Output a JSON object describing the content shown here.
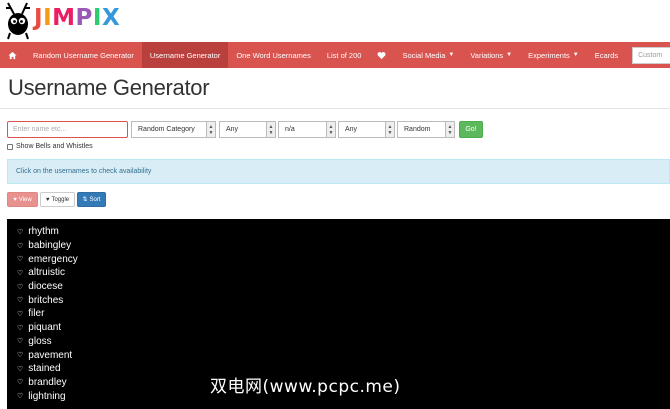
{
  "brand": {
    "letters": [
      {
        "ch": "J",
        "color": "#e94b3c"
      },
      {
        "ch": "I",
        "color": "#f39c12"
      },
      {
        "ch": "M",
        "color": "#e91e63"
      },
      {
        "ch": "P",
        "color": "#9b59b6"
      },
      {
        "ch": "I",
        "color": "#2ecc71"
      },
      {
        "ch": "X",
        "color": "#3498db"
      }
    ]
  },
  "colors": {
    "nav": "#d9534f",
    "nav_active": "#b9403c",
    "go": "#5cb85c",
    "sort": "#337ab7",
    "info_bg": "#d9edf7"
  },
  "nav": {
    "home_icon": "home-icon",
    "items": [
      {
        "label": "Random Username Generator",
        "active": false,
        "caret": false
      },
      {
        "label": "Username Generator",
        "active": true,
        "caret": false
      },
      {
        "label": "One Word Usernames",
        "active": false,
        "caret": false
      },
      {
        "label": "List of 200",
        "active": false,
        "caret": false
      }
    ],
    "heart_icon": "heart-icon",
    "items2": [
      {
        "label": "Social Media",
        "caret": true
      },
      {
        "label": "Variations",
        "caret": true
      },
      {
        "label": "Experiments",
        "caret": true
      },
      {
        "label": "Ecards",
        "caret": false
      }
    ],
    "search_placeholder": "Custom"
  },
  "page": {
    "title": "Username Generator"
  },
  "form": {
    "name_placeholder": "Enter name etc...",
    "selects": [
      {
        "value": "Random Category"
      },
      {
        "value": "Any"
      },
      {
        "value": "n/a"
      },
      {
        "value": "Any"
      },
      {
        "value": "Random"
      }
    ],
    "go_label": "Go!",
    "bells_label": "Show Bells and Whistles"
  },
  "info": {
    "text": "Click on the usernames to check availability"
  },
  "buttons": {
    "view": "View",
    "toggle": "Toggle",
    "sort": "Sort"
  },
  "results": [
    "rhythm",
    "babingley",
    "emergency",
    "altruistic",
    "diocese",
    "britches",
    "filer",
    "piquant",
    "gloss",
    "pavement",
    "stained",
    "brandley",
    "lightning"
  ],
  "watermark": "双电网(www.pcpc.me)"
}
